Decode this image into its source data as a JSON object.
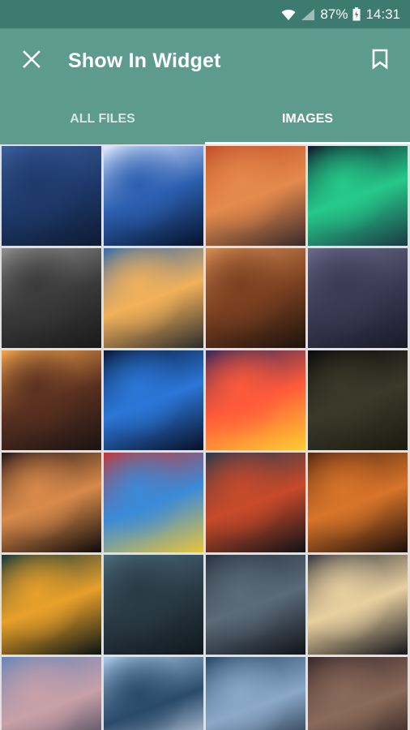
{
  "status": {
    "battery": "87%",
    "time": "14:31"
  },
  "toolbar": {
    "title": "Show In Widget",
    "close_icon": "close-icon",
    "bookmark_icon": "bookmark-icon"
  },
  "tabs": [
    {
      "label": "ALL FILES",
      "active": false
    },
    {
      "label": "IMAGES",
      "active": true
    }
  ],
  "colors": {
    "status_bar": "#3d7a6f",
    "toolbar": "#5d9b8f",
    "indicator": "#ffffff",
    "grid_gap": "#e0e0e0"
  },
  "images": [
    {
      "subject": "night-sky-mountains",
      "colors": [
        "#3a5f9a",
        "#1e3a6b",
        "#0d1b33"
      ]
    },
    {
      "subject": "galaxy",
      "colors": [
        "#dfe9ff",
        "#2c5fb0",
        "#06122b"
      ]
    },
    {
      "subject": "orange-sunset-clouds",
      "colors": [
        "#c2502a",
        "#e58a4c",
        "#3a2a2a"
      ]
    },
    {
      "subject": "aurora",
      "colors": [
        "#0f1b2b",
        "#26c98a",
        "#1a3a44"
      ]
    },
    {
      "subject": "city-street-bw",
      "colors": [
        "#8d8d8d",
        "#3a3a3a",
        "#1a1a1a"
      ]
    },
    {
      "subject": "railway-sunset",
      "colors": [
        "#3a6ea8",
        "#f2b15a",
        "#2b2b2b"
      ]
    },
    {
      "subject": "city-lights-dusk",
      "colors": [
        "#d48b54",
        "#7a4020",
        "#1e120c"
      ]
    },
    {
      "subject": "foggy-city-night",
      "colors": [
        "#6a6a86",
        "#3a3a55",
        "#1a1a2a"
      ]
    },
    {
      "subject": "street-canyon-sunset",
      "colors": [
        "#f0a24a",
        "#5a3020",
        "#1a1412"
      ]
    },
    {
      "subject": "blue-wave",
      "colors": [
        "#0a1a3a",
        "#2b77d8",
        "#081026"
      ]
    },
    {
      "subject": "geometric-logo",
      "colors": [
        "#3a2a5a",
        "#ff5a3a",
        "#ffcc33"
      ]
    },
    {
      "subject": "dark-streetlights",
      "colors": [
        "#0b0b0b",
        "#3a3a2a",
        "#1a1a10"
      ]
    },
    {
      "subject": "bokeh-tree",
      "colors": [
        "#2a1a1a",
        "#d88a4a",
        "#0e0a0a"
      ]
    },
    {
      "subject": "colorful-cables",
      "colors": [
        "#c03a3a",
        "#3a8ad8",
        "#e8c53a"
      ]
    },
    {
      "subject": "city-overpass",
      "colors": [
        "#2a3a4a",
        "#c84a2a",
        "#0e1218"
      ]
    },
    {
      "subject": "night-market",
      "colors": [
        "#5a2a14",
        "#d8742a",
        "#1a0e08"
      ]
    },
    {
      "subject": "rainy-neon-street",
      "colors": [
        "#1a3a3a",
        "#e8a02a",
        "#0a1414"
      ]
    },
    {
      "subject": "giant-creature-city",
      "colors": [
        "#4a6a7a",
        "#2a3a44",
        "#10181e"
      ]
    },
    {
      "subject": "snowy-night-street",
      "colors": [
        "#2a3440",
        "#5a6a78",
        "#10141a"
      ]
    },
    {
      "subject": "boardwalk-night",
      "colors": [
        "#3a3a40",
        "#e8d0a0",
        "#14141a"
      ]
    },
    {
      "subject": "mountain-sunset-sky",
      "colors": [
        "#6a86b8",
        "#c8a0a8",
        "#2a3448"
      ]
    },
    {
      "subject": "light-tunnel",
      "colors": [
        "#a8c8e8",
        "#2a4a6a",
        "#e8f0ff"
      ]
    },
    {
      "subject": "snowy-peak",
      "colors": [
        "#2a4a6a",
        "#8aa8c8",
        "#0e1a2a"
      ]
    },
    {
      "subject": "old-buildings",
      "colors": [
        "#3a2a2a",
        "#8a6a5a",
        "#1a1010"
      ]
    }
  ]
}
